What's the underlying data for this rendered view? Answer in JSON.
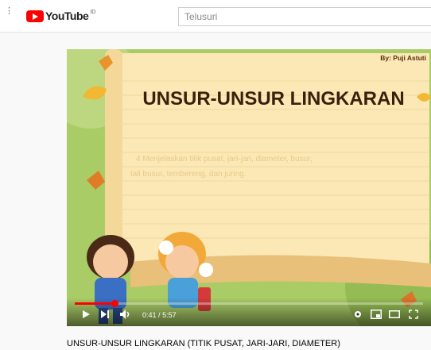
{
  "header": {
    "logo_text": "YouTube",
    "logo_region": "ID",
    "search_placeholder": "Telusuri"
  },
  "video": {
    "slide": {
      "author": "By: Puji Astuti",
      "title": "UNSUR-UNSUR LINGKARAN",
      "objective_line1": "4 Menjelaskan titik pusat, jari-jari, diameter, busur,",
      "objective_line2": "tali busur, tembereng, dan juring."
    },
    "current_time": "0:41",
    "duration": "5:57",
    "progress": 0.115,
    "title": "UNSUR-UNSUR LINGKARAN (TITIK PUSAT, JARI-JARI, DIAMETER)"
  },
  "colors": {
    "brand": "#ff0000",
    "scroll_paper": "#fbe8b5",
    "background_green": "#9ec45d"
  }
}
